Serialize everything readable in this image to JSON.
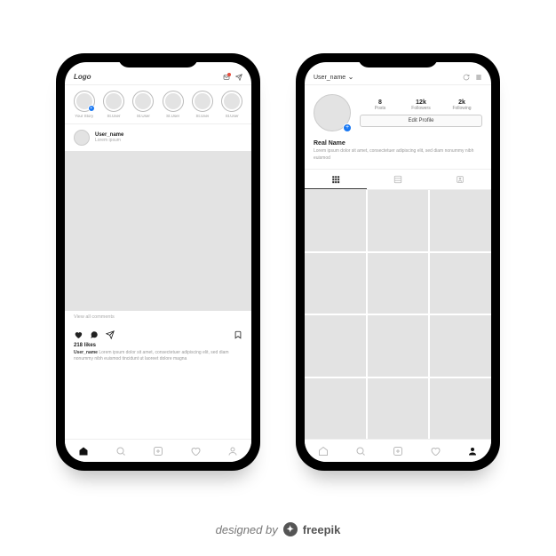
{
  "attribution": {
    "prefix": "designed by",
    "brand": "freepik"
  },
  "feed": {
    "logo": "Logo",
    "stories": [
      {
        "label": "Your Story",
        "add": true
      },
      {
        "label": "St.User",
        "add": false
      },
      {
        "label": "St.User",
        "add": false
      },
      {
        "label": "St.User",
        "add": false
      },
      {
        "label": "St.User",
        "add": false
      },
      {
        "label": "St.User",
        "add": false
      }
    ],
    "post": {
      "username": "User_name",
      "location": "Lorem ipsum",
      "view_comments": "View all comments",
      "likes": "218 likes",
      "caption_user": "User_name",
      "caption_text": "Lorem ipsum dolor sit amet, consectetuer adipiscing elit, sed diam nonummy nibh euismod tincidunt ut laoreet dolore magna"
    }
  },
  "profile": {
    "username": "User_name",
    "stats": {
      "posts": {
        "num": "8",
        "label": "Posts"
      },
      "followers": {
        "num": "12k",
        "label": "Followers"
      },
      "following": {
        "num": "2k",
        "label": "Following"
      }
    },
    "edit_label": "Edit Profile",
    "real_name": "Real Name",
    "bio": "Lorem ipsum dolor sit amet, consectetuer adipiscing elit, sed diam nonummy nibh euismod"
  }
}
